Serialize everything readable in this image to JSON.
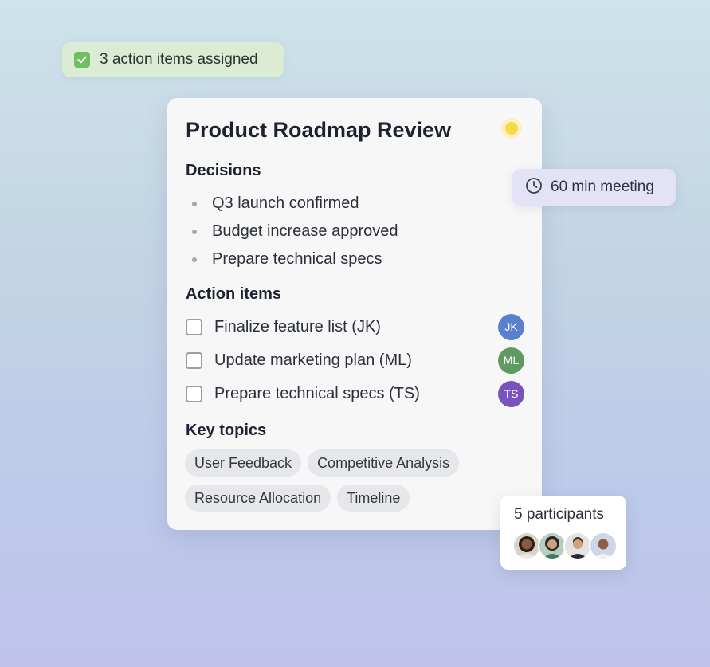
{
  "action_badge": {
    "text": "3 action items assigned",
    "icon": "checkbox-checked-icon",
    "color": "#6fbf5f"
  },
  "card": {
    "title": "Product Roadmap Review",
    "status_color": "#f5d94a",
    "decisions": {
      "heading": "Decisions",
      "items": [
        "Q3 launch confirmed",
        "Budget increase approved",
        "Prepare technical specs"
      ]
    },
    "action_items": {
      "heading": "Action items",
      "items": [
        {
          "label": "Finalize feature list (JK)",
          "initials": "JK",
          "color": "#5b7fcf",
          "checked": false
        },
        {
          "label": "Update marketing plan (ML)",
          "initials": "ML",
          "color": "#5f9a63",
          "checked": false
        },
        {
          "label": "Prepare technical specs (TS)",
          "initials": "TS",
          "color": "#7a52c0",
          "checked": false
        }
      ]
    },
    "key_topics": {
      "heading": "Key topics",
      "chips": [
        "User Feedback",
        "Competitive Analysis",
        "Resource Allocation",
        "Timeline"
      ]
    }
  },
  "meeting": {
    "text": "60 min meeting",
    "icon": "clock-icon"
  },
  "participants": {
    "text": "5 participants",
    "count_shown": 4
  }
}
